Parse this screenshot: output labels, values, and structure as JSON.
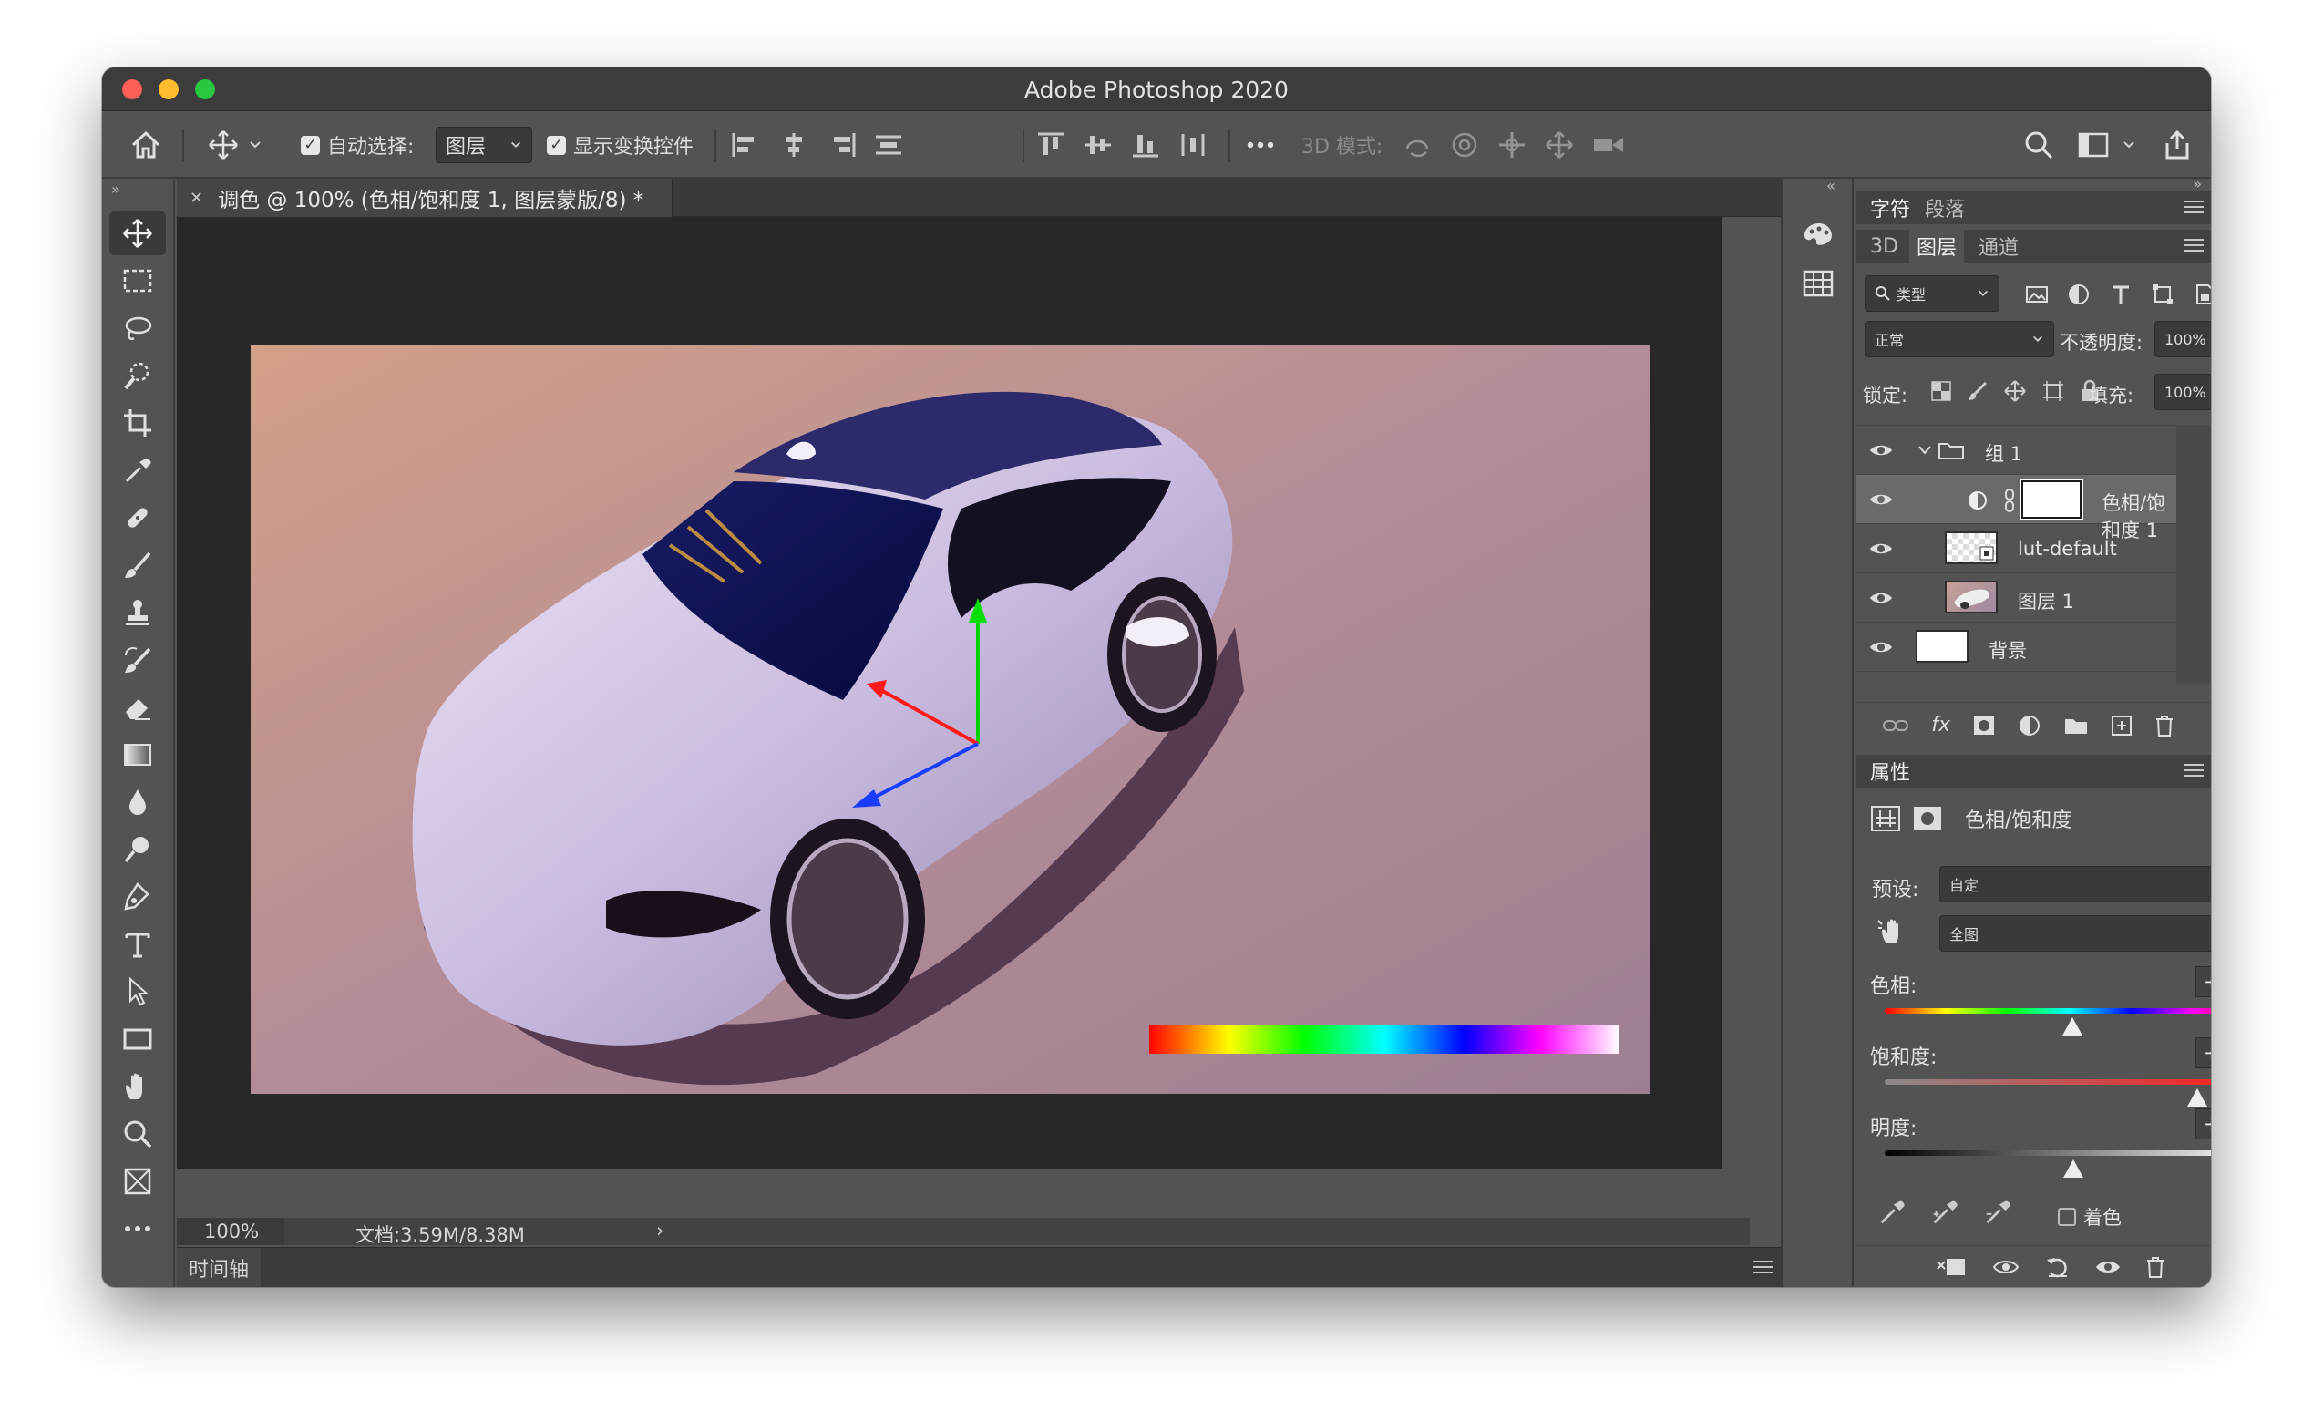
{
  "window": {
    "title": "Adobe Photoshop 2020"
  },
  "options_bar": {
    "auto_select_label": "自动选择:",
    "auto_select_value": "图层",
    "show_transform_label": "显示变换控件",
    "mode_3d_label": "3D 模式:"
  },
  "document": {
    "tab_title": "调色 @ 100% (色相/饱和度 1, 图层蒙版/8) *",
    "zoom": "100%",
    "doc_size": "文档:3.59M/8.38M"
  },
  "timeline": {
    "label": "时间轴"
  },
  "panels": {
    "top_tabs": [
      "字符",
      "段落"
    ],
    "layer_tabs": [
      "3D",
      "图层",
      "通道"
    ],
    "filter_kind": "类型",
    "blend_mode": "正常",
    "opacity_label": "不透明度:",
    "opacity_value": "100%",
    "lock_label": "锁定:",
    "fill_label": "填充:",
    "fill_value": "100%",
    "layers": [
      {
        "name": "组 1"
      },
      {
        "name": "色相/饱和度 1"
      },
      {
        "name": "lut-default"
      },
      {
        "name": "图层 1"
      },
      {
        "name": "背景"
      }
    ],
    "properties": {
      "tab": "属性",
      "adjustment_name": "色相/饱和度",
      "preset_label": "预设:",
      "preset_value": "自定",
      "channel_value": "全图",
      "hue_label": "色相:",
      "hue_value": "+3",
      "saturation_label": "饱和度:",
      "saturation_value": "+69",
      "lightness_label": "明度:",
      "lightness_value": "+2",
      "colorize_label": "着色"
    }
  },
  "colors": {
    "accent_red": "#ff4040",
    "panel_bg": "#535353",
    "dark_bg": "#282828"
  }
}
